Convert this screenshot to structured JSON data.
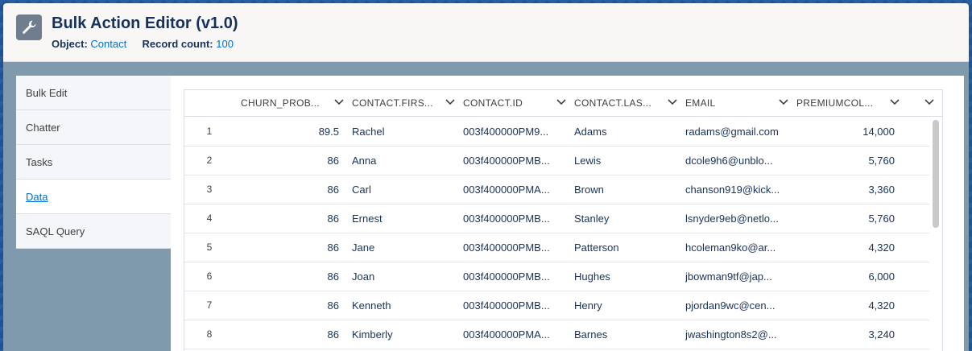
{
  "header": {
    "title": "Bulk Action Editor (v1.0)",
    "object_label": "Object:",
    "object_value": "Contact",
    "record_count_label": "Record count:",
    "record_count_value": "100",
    "icon": "wrench-icon"
  },
  "sidebar": {
    "items": [
      {
        "label": "Bulk Edit"
      },
      {
        "label": "Chatter"
      },
      {
        "label": "Tasks"
      },
      {
        "label": "Data"
      },
      {
        "label": "SAQL Query"
      }
    ],
    "active_index": 3
  },
  "grid": {
    "columns": [
      "CHURN_PROB...",
      "CONTACT.FIRS...",
      "CONTACT.ID",
      "CONTACT.LAS...",
      "EMAIL",
      "PREMIUMCOL..."
    ],
    "rows": [
      {
        "idx": "1",
        "churn": "89.5",
        "first": "Rachel",
        "id": "003f400000PM9...",
        "last": "Adams",
        "email": "radams@gmail.com",
        "premium": "14,000"
      },
      {
        "idx": "2",
        "churn": "86",
        "first": "Anna",
        "id": "003f400000PMB...",
        "last": "Lewis",
        "email": "dcole9h6@unblo...",
        "premium": "5,760"
      },
      {
        "idx": "3",
        "churn": "86",
        "first": "Carl",
        "id": "003f400000PMA...",
        "last": "Brown",
        "email": "chanson919@kick...",
        "premium": "3,360"
      },
      {
        "idx": "4",
        "churn": "86",
        "first": "Ernest",
        "id": "003f400000PMB...",
        "last": "Stanley",
        "email": "lsnyder9eb@netlo...",
        "premium": "5,760"
      },
      {
        "idx": "5",
        "churn": "86",
        "first": "Jane",
        "id": "003f400000PMB...",
        "last": "Patterson",
        "email": "hcoleman9ko@ar...",
        "premium": "4,320"
      },
      {
        "idx": "6",
        "churn": "86",
        "first": "Joan",
        "id": "003f400000PMB...",
        "last": "Hughes",
        "email": "jbowman9tf@jap...",
        "premium": "6,000"
      },
      {
        "idx": "7",
        "churn": "86",
        "first": "Kenneth",
        "id": "003f400000PMB...",
        "last": "Henry",
        "email": "pjordan9wc@cen...",
        "premium": "4,320"
      },
      {
        "idx": "8",
        "churn": "86",
        "first": "Kimberly",
        "id": "003f400000PMA...",
        "last": "Barnes",
        "email": "jwashington8s2@...",
        "premium": "3,240"
      }
    ]
  },
  "colors": {
    "accent": "#0070d2",
    "text_dark": "#16325c",
    "panel_bg": "#7f99ad"
  }
}
